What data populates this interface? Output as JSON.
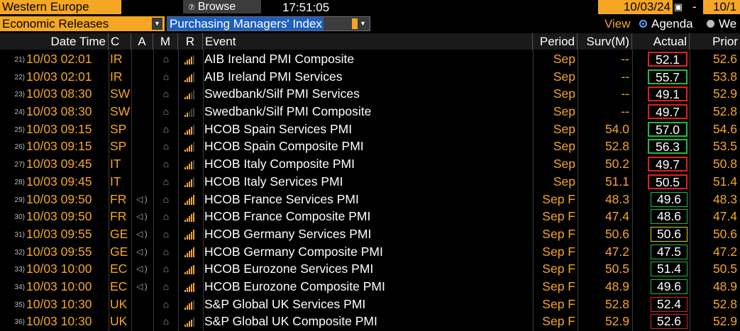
{
  "topbar": {
    "region": "Western Europe",
    "browse_label": "Browse",
    "browse_icon": "browse-icon",
    "time": "17:51:05",
    "date_from": "10/03/24",
    "date_to": "10/1"
  },
  "filters": {
    "category": "Economic Releases",
    "search": "Purchasing Managers' Index",
    "view_label": "View",
    "view_options": [
      "Agenda",
      "We"
    ],
    "view_selected": "Agenda"
  },
  "columns": [
    "Date Time",
    "C",
    "A",
    "M",
    "R",
    "Event",
    "Period",
    "Surv(M)",
    "Actual",
    "Prior"
  ],
  "colors": {
    "accent": "#f5a623",
    "box_red": "#e02020",
    "box_green": "#22b84a",
    "box_yellow": "#e5d300",
    "selection_blue": "#1f5fbf"
  },
  "rows": [
    {
      "num": "21)",
      "datetime": "10/03 02:01",
      "country": "IR",
      "alert": "",
      "event": "AIB Ireland PMI Composite",
      "period": "Sep",
      "survey": "--",
      "actual": "52.1",
      "prior": "52.6",
      "box": "red",
      "relevance": 3
    },
    {
      "num": "22)",
      "datetime": "10/03 02:01",
      "country": "IR",
      "alert": "",
      "event": "AIB Ireland PMI Services",
      "period": "Sep",
      "survey": "--",
      "actual": "55.7",
      "prior": "53.8",
      "box": "green",
      "relevance": 3
    },
    {
      "num": "23)",
      "datetime": "10/03 08:30",
      "country": "SW",
      "alert": "",
      "event": "Swedbank/Silf PMI Services",
      "period": "Sep",
      "survey": "--",
      "actual": "49.1",
      "prior": "52.9",
      "box": "red",
      "relevance": 2
    },
    {
      "num": "24)",
      "datetime": "10/03 08:30",
      "country": "SW",
      "alert": "",
      "event": "Swedbank/Silf PMI Composite",
      "period": "Sep",
      "survey": "--",
      "actual": "49.7",
      "prior": "52.8",
      "box": "red",
      "relevance": 1
    },
    {
      "num": "25)",
      "datetime": "10/03 09:15",
      "country": "SP",
      "alert": "",
      "event": "HCOB Spain Services PMI",
      "period": "Sep",
      "survey": "54.0",
      "actual": "57.0",
      "prior": "54.6",
      "box": "green",
      "relevance": 3
    },
    {
      "num": "26)",
      "datetime": "10/03 09:15",
      "country": "SP",
      "alert": "",
      "event": "HCOB Spain Composite PMI",
      "period": "Sep",
      "survey": "52.8",
      "actual": "56.3",
      "prior": "53.5",
      "box": "green",
      "relevance": 3
    },
    {
      "num": "27)",
      "datetime": "10/03 09:45",
      "country": "IT",
      "alert": "",
      "event": "HCOB Italy Composite PMI",
      "period": "Sep",
      "survey": "50.2",
      "actual": "49.7",
      "prior": "50.8",
      "box": "red",
      "relevance": 3
    },
    {
      "num": "28)",
      "datetime": "10/03 09:45",
      "country": "IT",
      "alert": "",
      "event": "HCOB Italy Services PMI",
      "period": "Sep",
      "survey": "51.1",
      "actual": "50.5",
      "prior": "51.4",
      "box": "red",
      "relevance": 3
    },
    {
      "num": "29)",
      "datetime": "10/03 09:50",
      "country": "FR",
      "alert": "speaker-icon",
      "event": "HCOB France Services PMI",
      "period": "Sep F",
      "survey": "48.3",
      "actual": "49.6",
      "prior": "48.3",
      "box": "green",
      "relevance": 4
    },
    {
      "num": "30)",
      "datetime": "10/03 09:50",
      "country": "FR",
      "alert": "speaker-icon",
      "event": "HCOB France Composite PMI",
      "period": "Sep F",
      "survey": "47.4",
      "actual": "48.6",
      "prior": "47.4",
      "box": "green",
      "relevance": 4
    },
    {
      "num": "31)",
      "datetime": "10/03 09:55",
      "country": "GE",
      "alert": "speaker-icon",
      "event": "HCOB Germany Services PMI",
      "period": "Sep F",
      "survey": "50.6",
      "actual": "50.6",
      "prior": "50.6",
      "box": "yellow",
      "relevance": 4
    },
    {
      "num": "32)",
      "datetime": "10/03 09:55",
      "country": "GE",
      "alert": "speaker-icon",
      "event": "HCOB Germany Composite PMI",
      "period": "Sep F",
      "survey": "47.2",
      "actual": "47.5",
      "prior": "47.2",
      "box": "green",
      "relevance": 4
    },
    {
      "num": "33)",
      "datetime": "10/03 10:00",
      "country": "EC",
      "alert": "speaker-icon",
      "event": "HCOB Eurozone Services PMI",
      "period": "Sep F",
      "survey": "50.5",
      "actual": "51.4",
      "prior": "50.5",
      "box": "green",
      "relevance": 4
    },
    {
      "num": "34)",
      "datetime": "10/03 10:00",
      "country": "EC",
      "alert": "speaker-icon",
      "event": "HCOB Eurozone Composite PMI",
      "period": "Sep F",
      "survey": "48.9",
      "actual": "49.6",
      "prior": "48.9",
      "box": "green",
      "relevance": 4
    },
    {
      "num": "35)",
      "datetime": "10/03 10:30",
      "country": "UK",
      "alert": "",
      "event": "S&P Global UK Services PMI",
      "period": "Sep F",
      "survey": "52.8",
      "actual": "52.4",
      "prior": "52.8",
      "box": "red",
      "relevance": 3
    },
    {
      "num": "36)",
      "datetime": "10/03 10:30",
      "country": "UK",
      "alert": "",
      "event": "S&P Global UK Composite PMI",
      "period": "Sep F",
      "survey": "52.9",
      "actual": "52.6",
      "prior": "52.9",
      "box": "red",
      "relevance": 3
    }
  ]
}
